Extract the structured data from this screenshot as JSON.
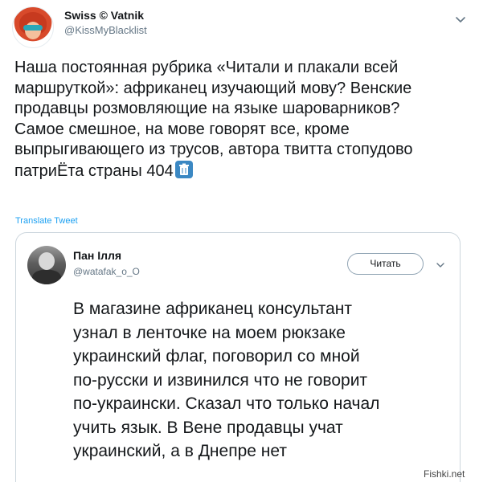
{
  "tweet": {
    "author_name": "Swiss © Vatnik",
    "author_handle": "@KissMyBlacklist",
    "text_lines": [
      "Наша постоянная рубрика «Читали и плакали всей",
      "маршруткой»: африканец изучающий мову? Венские",
      "продавцы розмовляющие на языке шароварников?",
      "Самое смешное, на мове говорят все, кроме",
      "выпрыгивающего из трусов, автора твитта стопудово",
      "патриЁта страны 404"
    ],
    "trailing_emoji": "wastebasket-icon",
    "translate_label": "Translate Tweet"
  },
  "quoted": {
    "author_name": "Пан Ілля",
    "author_handle": "@watafak_o_O",
    "follow_label": "Читать",
    "text_lines": [
      "В магазине африканец консультант",
      "узнал в ленточке на моем рюкзаке",
      "украинский флаг, поговорил со мной",
      "по-русски и извинился что не говорит",
      "по-украински. Сказал что только начал",
      "учить язык. В Вене продавцы учат",
      "украинский, а в Днепре нет"
    ]
  },
  "watermark": "Fishki.net",
  "colors": {
    "text": "#14171a",
    "secondary": "#657786",
    "link": "#1da1f2",
    "border": "#ccd6dd",
    "emoji_bg": "#3b88c3"
  }
}
